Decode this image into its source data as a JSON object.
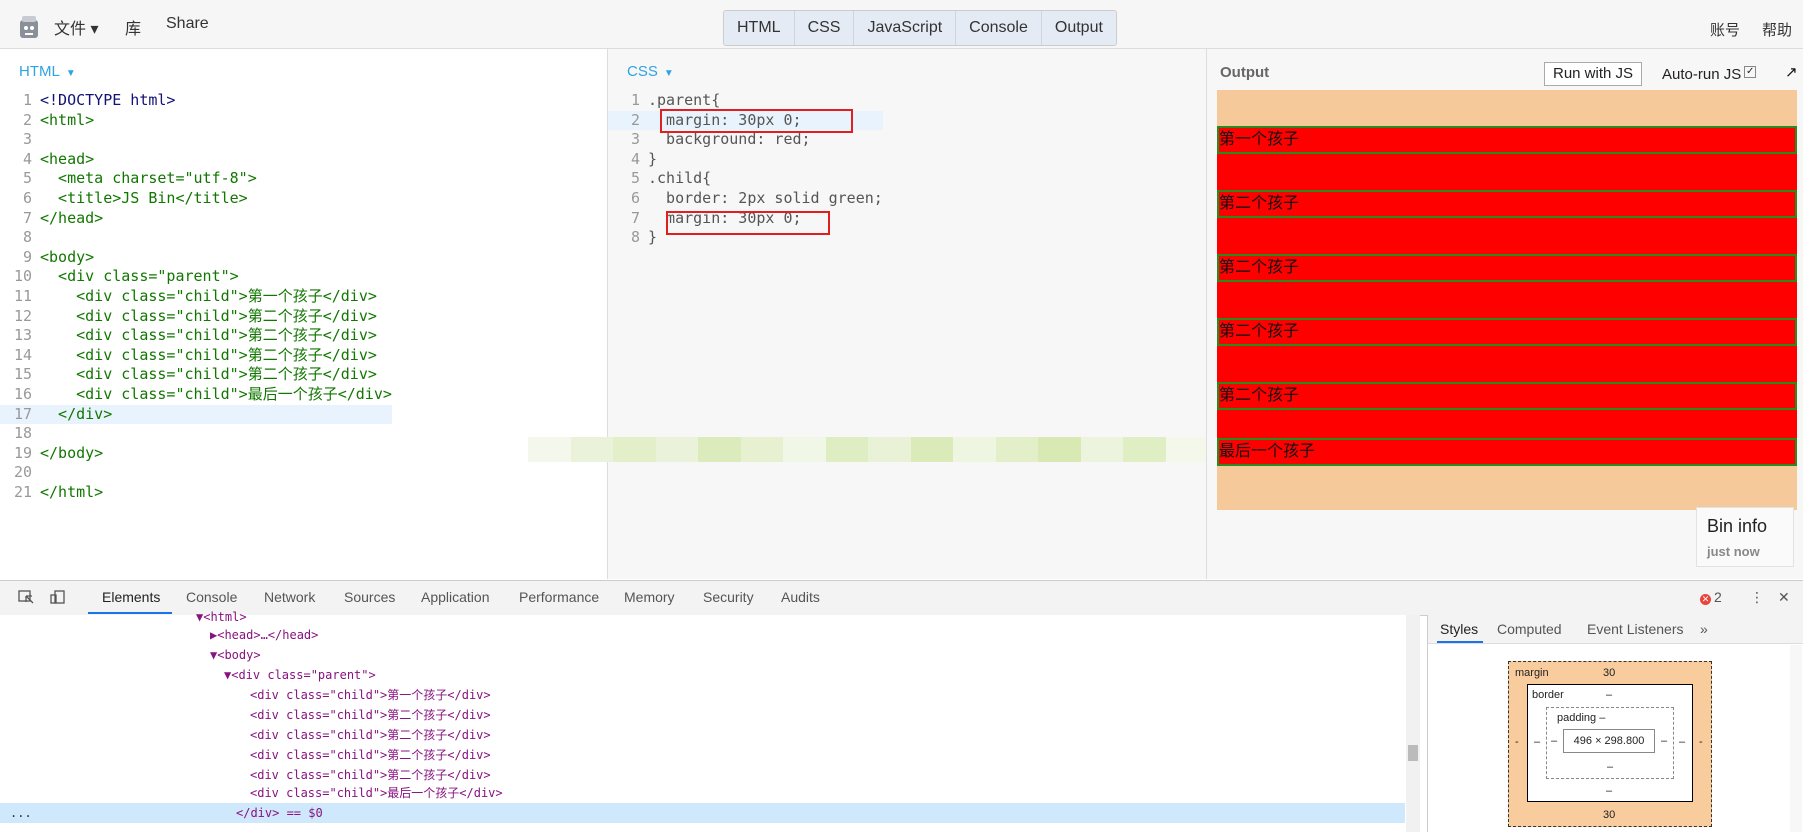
{
  "toolbar": {
    "menu_file": "文件 ▾",
    "menu_library": "库",
    "menu_share": "Share",
    "tabs": [
      "HTML",
      "CSS",
      "JavaScript",
      "Console",
      "Output"
    ],
    "account": "账号",
    "help": "帮助"
  },
  "html_panel": {
    "label": "HTML",
    "line_numbers": [
      "1",
      "2",
      "3",
      "4",
      "5",
      "6",
      "7",
      "8",
      "9",
      "10",
      "11",
      "12",
      "13",
      "14",
      "15",
      "16",
      "17",
      "18",
      "19",
      "20",
      "21"
    ],
    "lines": [
      "<!DOCTYPE html>",
      "<html>",
      "",
      "<head>",
      "  <meta charset=\"utf-8\">",
      "  <title>JS Bin</title>",
      "</head>",
      "",
      "<body>",
      "  <div class=\"parent\">",
      "    <div class=\"child\">第一个孩子</div>",
      "    <div class=\"child\">第二个孩子</div>",
      "    <div class=\"child\">第二个孩子</div>",
      "    <div class=\"child\">第二个孩子</div>",
      "    <div class=\"child\">第二个孩子</div>",
      "    <div class=\"child\">最后一个孩子</div>",
      "  </div>",
      "",
      "</body>",
      "",
      "</html>"
    ]
  },
  "css_panel": {
    "label": "CSS",
    "line_numbers": [
      "1",
      "2",
      "3",
      "4",
      "5",
      "6",
      "7",
      "8"
    ],
    "lines": [
      ".parent{",
      "  margin: 30px 0;",
      "  background: red;",
      "}",
      ".child{",
      "  border: 2px solid green;",
      "  margin: 30px 0;",
      "}"
    ]
  },
  "output_panel": {
    "label": "Output",
    "run_button": "Run with JS",
    "autorun_label": "Auto-run JS",
    "autorun_check": "✓",
    "popout": "↗",
    "children": [
      "第一个孩子",
      "第二个孩子",
      "第二个孩子",
      "第二个孩子",
      "第二个孩子",
      "最后一个孩子"
    ],
    "bin_info_title": "Bin info",
    "bin_info_sub": "just now"
  },
  "devtools": {
    "tabs": [
      "Elements",
      "Console",
      "Network",
      "Sources",
      "Application",
      "Performance",
      "Memory",
      "Security",
      "Audits"
    ],
    "error_count": "2",
    "error_icon": "✕",
    "menu_dots": "⋮",
    "close": "✕",
    "dom_lines": [
      "▼<html>",
      "▶<head>…</head>",
      "▼<body>",
      "▼<div class=\"parent\">",
      "<div class=\"child\">第一个孩子</div>",
      "<div class=\"child\">第二个孩子</div>",
      "<div class=\"child\">第二个孩子</div>",
      "<div class=\"child\">第二个孩子</div>",
      "<div class=\"child\">第二个孩子</div>",
      "<div class=\"child\">最后一个孩子</div>",
      "</div> == $0"
    ],
    "selected_prefix": "...",
    "styles_tabs": [
      "Styles",
      "Computed",
      "Event Listeners",
      "»"
    ],
    "box_model": {
      "margin_label": "margin",
      "margin_top": "30",
      "margin_bottom": "30",
      "margin_left": "-",
      "margin_right": "-",
      "border_label": "border",
      "border_top": "–",
      "border_bottom": "–",
      "border_left": "–",
      "border_right": "–",
      "padding_label": "padding –",
      "padding_bottom": "–",
      "padding_left": "–",
      "padding_right": "–",
      "content_size": "496 × 298.800"
    }
  },
  "colors": {
    "accent_blue": "#2ea3e6",
    "highlight_red": "#e02020",
    "parent_bg": "#ff0000",
    "child_border": "#2a8a1f",
    "margin_orange": "#f5c99a"
  }
}
